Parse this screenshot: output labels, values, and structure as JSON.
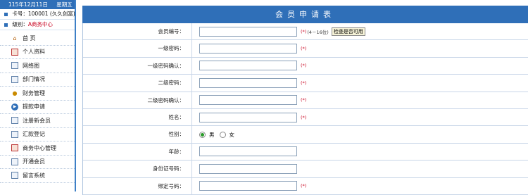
{
  "sidebar": {
    "date": "115年12月11日",
    "weekday": "星期五",
    "card_label": "卡号：100001 (久久创富)",
    "level_prefix": "级别：",
    "level_value": "A商务中心",
    "items": [
      {
        "label": "首 页",
        "icon": "house-icon"
      },
      {
        "label": "个人资料",
        "icon": "profile-icon"
      },
      {
        "label": "网络图",
        "icon": "network-icon"
      },
      {
        "label": "部门情况",
        "icon": "department-icon"
      },
      {
        "label": "财务管理",
        "icon": "coins-icon"
      },
      {
        "label": "提款申请",
        "icon": "arrow-icon"
      },
      {
        "label": "注册新会员",
        "icon": "register-icon"
      },
      {
        "label": "汇款登记",
        "icon": "remit-icon"
      },
      {
        "label": "商务中心管理",
        "icon": "center-icon"
      },
      {
        "label": "开通会员",
        "icon": "open-icon"
      },
      {
        "label": "留言系统",
        "icon": "message-icon"
      }
    ]
  },
  "form": {
    "title": "会员申请表",
    "required_mark": "(*)",
    "member_no": {
      "label": "会员编号：",
      "value": "",
      "hint": "(4－16位)",
      "button": "检查是否可用"
    },
    "pwd1": {
      "label": "一级密码：",
      "value": ""
    },
    "pwd1_confirm": {
      "label": "一级密码确认：",
      "value": ""
    },
    "pwd2": {
      "label": "二级密码：",
      "value": ""
    },
    "pwd2_confirm": {
      "label": "二级密码确认：",
      "value": ""
    },
    "name": {
      "label": "姓名：",
      "value": ""
    },
    "gender": {
      "label": "性别：",
      "male": "男",
      "female": "女",
      "selected": "男"
    },
    "age": {
      "label": "年龄：",
      "value": ""
    },
    "id_card": {
      "label": "身份证号码：",
      "value": ""
    },
    "phone": {
      "label": "绑定号码：",
      "value": ""
    }
  },
  "colors": {
    "accent": "#2f6fb8",
    "required": "#c8001e"
  }
}
